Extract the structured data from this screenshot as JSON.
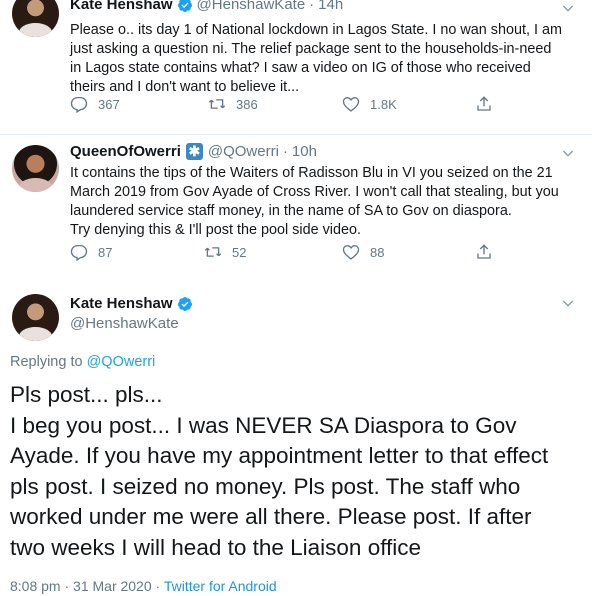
{
  "tweet1": {
    "name": "Kate Henshaw",
    "handle": "@HenshawKate",
    "time": "14h",
    "lines": [
      "Please o.. its day 1 of National lockdown in Lagos State. I no wan shout, I am",
      "just asking a question ni. The relief package sent to the households-in-need",
      "in Lagos state contains what? I saw a video on IG of those who received",
      "theirs and I don't want to believe it..."
    ],
    "replies": "367",
    "retweets": "386",
    "likes": "1.8K"
  },
  "tweet2": {
    "name": "QueenOfOwerri",
    "handle": "@QOwerri",
    "time": "10h",
    "lines": [
      "It contains the tips of the Waiters of Radisson Blu in VI you seized on the 21",
      "March 2019 from Gov Ayade of Cross River. I won't call that stealing, but you",
      "laundered service staff money, in the name of SA to Gov on diaspora.",
      "Try denying this & I'll post the pool side video."
    ],
    "replies": "87",
    "retweets": "52",
    "likes": "88"
  },
  "main_tweet": {
    "name": "Kate Henshaw",
    "handle": "@HenshawKate",
    "replying_prefix": "Replying to ",
    "replying_handle": "@QOwerri",
    "lines": [
      "Pls post... pls...",
      "I beg you post... I was NEVER SA Diaspora to Gov",
      "Ayade. If you have my appointment letter to that effect",
      "pls post. I seized no money. Pls post. The staff who",
      "worked under me were all there. Please post. If after",
      "two weeks I will head to the Liaison office"
    ],
    "timestamp": "8:08 pm · 31 Mar 2020 · ",
    "source": "Twitter for Android"
  },
  "colors": {
    "accent": "#1da1f2",
    "muted": "#657786",
    "text": "#14171a",
    "divider": "#e6ecf0"
  },
  "icons": [
    "verified-badge-icon",
    "chevron-down-icon",
    "reply-icon",
    "retweet-icon",
    "like-icon",
    "share-icon"
  ]
}
